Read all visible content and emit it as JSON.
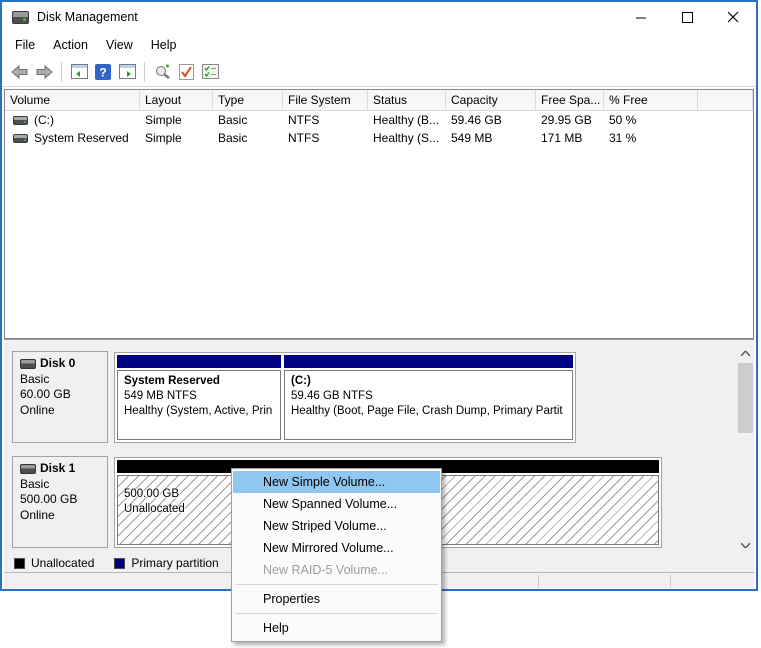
{
  "window": {
    "title": "Disk Management",
    "controls": [
      "minimize",
      "maximize",
      "close"
    ]
  },
  "menubar": {
    "items": [
      "File",
      "Action",
      "View",
      "Help"
    ]
  },
  "toolbar": {
    "icons": [
      "back",
      "forward",
      "console-tree",
      "help",
      "action-pane",
      "rescan-disks",
      "check-disk",
      "task-list"
    ]
  },
  "volume_list": {
    "columns": [
      "Volume",
      "Layout",
      "Type",
      "File System",
      "Status",
      "Capacity",
      "Free Spa...",
      "% Free"
    ],
    "rows": [
      {
        "volume": "(C:)",
        "layout": "Simple",
        "type": "Basic",
        "fs": "NTFS",
        "status": "Healthy (B...",
        "capacity": "59.46 GB",
        "free": "29.95 GB",
        "pct": "50 %"
      },
      {
        "volume": "System Reserved",
        "layout": "Simple",
        "type": "Basic",
        "fs": "NTFS",
        "status": "Healthy (S...",
        "capacity": "549 MB",
        "free": "171 MB",
        "pct": "31 %"
      }
    ]
  },
  "disks": [
    {
      "name": "Disk 0",
      "type": "Basic",
      "size": "60.00 GB",
      "status": "Online",
      "partitions": [
        {
          "title": "System Reserved",
          "line2": "549 MB NTFS",
          "line3": "Healthy (System, Active, Prin"
        },
        {
          "title": "(C:)",
          "line2": "59.46 GB NTFS",
          "line3": "Healthy (Boot, Page File, Crash Dump, Primary Partit"
        }
      ]
    },
    {
      "name": "Disk 1",
      "type": "Basic",
      "size": "500.00 GB",
      "status": "Online",
      "partitions": [
        {
          "title": "",
          "line2": "500.00 GB",
          "line3": "Unallocated"
        }
      ]
    }
  ],
  "legend": [
    {
      "label": "Unallocated",
      "color": "#000000"
    },
    {
      "label": "Primary partition",
      "color": "#000082"
    }
  ],
  "context_menu": {
    "items": [
      {
        "label": "New Simple Volume...",
        "state": "highlighted"
      },
      {
        "label": "New Spanned Volume...",
        "state": "normal"
      },
      {
        "label": "New Striped Volume...",
        "state": "normal"
      },
      {
        "label": "New Mirrored Volume...",
        "state": "normal"
      },
      {
        "label": "New RAID-5 Volume...",
        "state": "disabled"
      },
      {
        "type": "separator"
      },
      {
        "label": "Properties",
        "state": "normal"
      },
      {
        "type": "separator"
      },
      {
        "label": "Help",
        "state": "normal"
      }
    ]
  },
  "colors": {
    "window_border": "#2a70c8",
    "primary_partition": "#000082",
    "unallocated": "#000000",
    "menu_highlight": "#8fc7f0"
  }
}
